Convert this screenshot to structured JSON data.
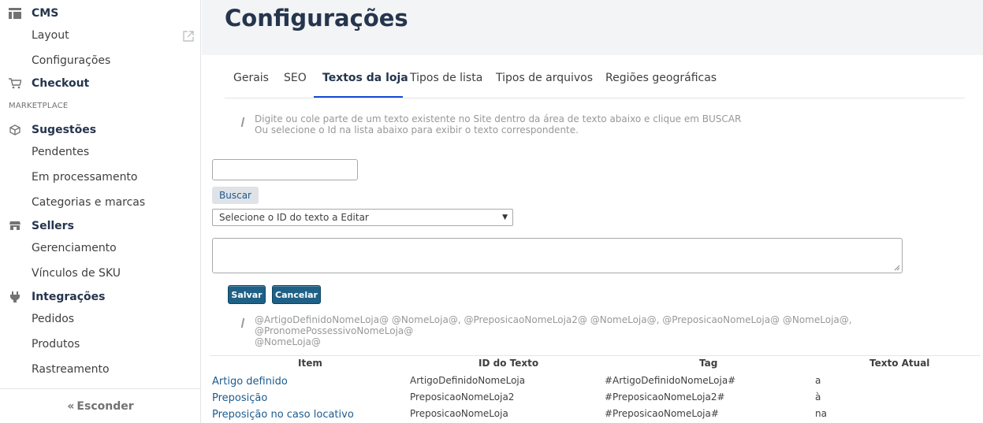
{
  "sidebar": {
    "cms": {
      "label": "CMS",
      "icon": "layout-icon"
    },
    "cms_items": [
      "Layout",
      "Configurações"
    ],
    "checkout": {
      "label": "Checkout",
      "icon": "cart-icon"
    },
    "marketplace_label": "MARKETPLACE",
    "sugestoes": {
      "label": "Sugestões",
      "icon": "box-icon"
    },
    "sugestoes_items": [
      "Pendentes",
      "Em processamento",
      "Categorias e marcas"
    ],
    "sellers": {
      "label": "Sellers",
      "icon": "store-icon"
    },
    "sellers_items": [
      "Gerenciamento",
      "Vínculos de SKU"
    ],
    "integracoes": {
      "label": "Integrações",
      "icon": "plug-icon"
    },
    "integracoes_items": [
      "Pedidos",
      "Produtos",
      "Rastreamento"
    ],
    "hide_label": "Esconder"
  },
  "header": {
    "title": "Configurações"
  },
  "tabs": [
    "Gerais",
    "SEO",
    "Textos da loja",
    "Tipos de lista",
    "Tipos de arquivos",
    "Regiões geográficas"
  ],
  "active_tab": "Textos da loja",
  "info1": {
    "line1": "Digite ou cole parte de um texto existente no Site dentro da área de texto abaixo e clique em BUSCAR",
    "line2": "Ou selecione o Id na lista abaixo para exibir o texto correspondente."
  },
  "form": {
    "search_value": "",
    "buscar_label": "Buscar",
    "select_value": "Selecione o ID do texto a Editar",
    "textarea_value": "",
    "salvar_label": "Salvar",
    "cancelar_label": "Cancelar"
  },
  "info2": {
    "line1": "@ArtigoDefinidoNomeLoja@ @NomeLoja@, @PreposicaoNomeLoja2@ @NomeLoja@, @PreposicaoNomeLoja@ @NomeLoja@, @PronomePossessivoNomeLoja@",
    "line2": "@NomeLoja@"
  },
  "table": {
    "headers": [
      "Item",
      "ID do Texto",
      "Tag",
      "Texto Atual"
    ],
    "rows": [
      {
        "item": "Artigo definido",
        "id": "ArtigoDefinidoNomeLoja",
        "tag": "#ArtigoDefinidoNomeLoja#",
        "texto": "a"
      },
      {
        "item": "Preposição",
        "id": "PreposicaoNomeLoja2",
        "tag": "#PreposicaoNomeLoja2#",
        "texto": "à"
      },
      {
        "item": "Preposição no caso locativo",
        "id": "PreposicaoNomeLoja",
        "tag": "#PreposicaoNomeLoja#",
        "texto": "na"
      }
    ]
  },
  "colors": {
    "accent": "#134cd8",
    "link": "#1b5b8f",
    "button": "#1f6086",
    "header_bg": "#f2f4f5"
  }
}
